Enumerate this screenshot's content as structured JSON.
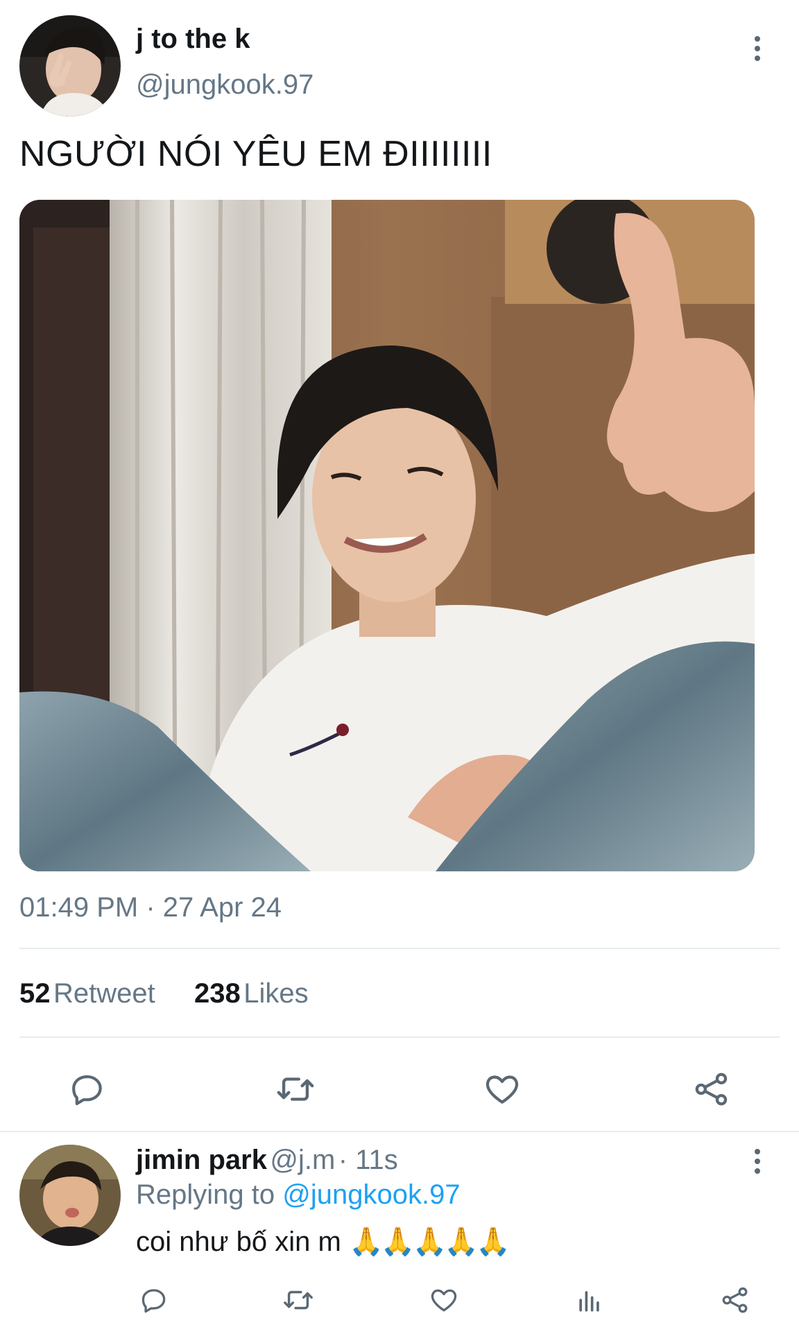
{
  "tweet": {
    "author_name": "j to the k",
    "author_handle": "@jungkook.97",
    "text": "NGƯỜI NÓI YÊU EM ĐIIIIIIII",
    "timestamp": "01:49 PM · 27 Apr 24",
    "retweet_count": "52",
    "retweet_label": "Retweet",
    "likes_count": "238",
    "likes_label": "Likes",
    "menu_icon": "more-vertical-icon",
    "actions": [
      "reply-icon",
      "retweet-icon",
      "like-icon",
      "share-icon"
    ]
  },
  "reply": {
    "author_name": "jimin park",
    "author_handle": "@j.m",
    "time": "· 11s",
    "replying_prefix": "Replying to",
    "replying_to": "@jungkook.97",
    "text": "coi như bố xin m",
    "emoji": "🙏🙏🙏🙏🙏",
    "menu_icon": "more-vertical-icon",
    "actions": [
      "reply-icon",
      "retweet-icon",
      "like-icon",
      "analytics-icon",
      "share-icon"
    ]
  },
  "colors": {
    "text_primary": "#14171a",
    "text_secondary": "#657786",
    "link": "#1da1f2",
    "icon": "#5b6873",
    "divider": "#e6ecf0"
  }
}
